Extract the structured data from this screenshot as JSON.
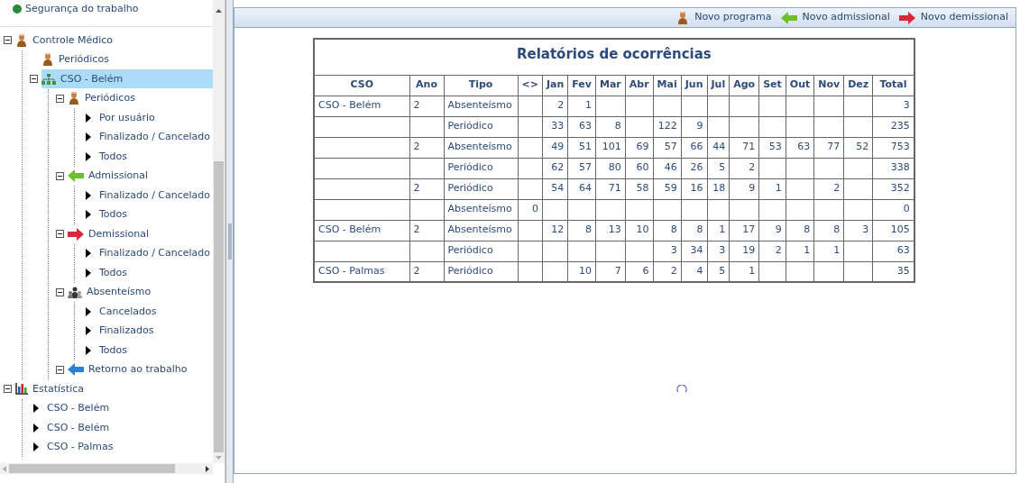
{
  "tree": {
    "top_item": {
      "label": "Segurança do trabalho"
    },
    "nodes": [
      {
        "label": "Controle Médico",
        "kind": "doctor",
        "expanded": true,
        "selected": false,
        "children": [
          {
            "label": "Periódicos",
            "kind": "doctor",
            "selected": false
          },
          {
            "label": "CSO - Belém",
            "kind": "network",
            "expanded": true,
            "selected": true,
            "children": [
              {
                "label": "Periódicos",
                "kind": "doctor",
                "expanded": true,
                "selected": false,
                "children": [
                  {
                    "label": "Por usuário",
                    "kind": "leaf",
                    "selected": false
                  },
                  {
                    "label": "Finalizado / Cancelado",
                    "kind": "leaf",
                    "selected": false
                  },
                  {
                    "label": "Todos",
                    "kind": "leaf",
                    "selected": false
                  }
                ]
              },
              {
                "label": "Admissional",
                "kind": "arrow-green",
                "expanded": true,
                "selected": false,
                "children": [
                  {
                    "label": "Finalizado / Cancelado",
                    "kind": "leaf",
                    "selected": false
                  },
                  {
                    "label": "Todos",
                    "kind": "leaf",
                    "selected": false
                  }
                ]
              },
              {
                "label": "Demissional",
                "kind": "arrow-red",
                "expanded": true,
                "selected": false,
                "children": [
                  {
                    "label": "Finalizado / Cancelado",
                    "kind": "leaf",
                    "selected": false
                  },
                  {
                    "label": "Todos",
                    "kind": "leaf",
                    "selected": false
                  }
                ]
              },
              {
                "label": "Absenteísmo",
                "kind": "people",
                "expanded": true,
                "selected": false,
                "children": [
                  {
                    "label": "Cancelados",
                    "kind": "leaf",
                    "selected": false
                  },
                  {
                    "label": "Finalizados",
                    "kind": "leaf",
                    "selected": false
                  },
                  {
                    "label": "Todos",
                    "kind": "leaf",
                    "selected": false
                  }
                ]
              },
              {
                "label": "Retorno ao trabalho",
                "kind": "arrow-blue",
                "expanded": true,
                "selected": false
              }
            ]
          }
        ]
      },
      {
        "label": "Estatística",
        "kind": "chart",
        "expanded": true,
        "selected": false,
        "children": [
          {
            "label": "CSO - Belém",
            "kind": "leaf",
            "selected": false
          },
          {
            "label": "CSO - Belém",
            "kind": "leaf",
            "selected": false
          },
          {
            "label": "CSO - Palmas",
            "kind": "leaf",
            "selected": false
          }
        ]
      }
    ]
  },
  "toolbar": [
    {
      "label": "Novo programa",
      "kind": "doctor"
    },
    {
      "label": "Novo admissional",
      "kind": "arrow-green"
    },
    {
      "label": "Novo demissional",
      "kind": "arrow-red"
    }
  ],
  "report": {
    "title": "Relatórios de ocorrências",
    "columns": [
      "CSO",
      "Ano",
      "Tipo",
      "<>",
      "Jan",
      "Fev",
      "Mar",
      "Abr",
      "Mai",
      "Jun",
      "Jul",
      "Ago",
      "Set",
      "Out",
      "Nov",
      "Dez",
      "Total"
    ],
    "rows": [
      [
        "CSO - Belém",
        "2",
        "Absenteísmo",
        null,
        "2",
        "1",
        null,
        null,
        null,
        null,
        null,
        null,
        null,
        null,
        null,
        null,
        "3"
      ],
      [
        null,
        null,
        "Periódico",
        null,
        "33",
        "63",
        "8",
        null,
        "122",
        "9",
        null,
        null,
        null,
        null,
        null,
        null,
        "235"
      ],
      [
        null,
        "2",
        "Absenteísmo",
        null,
        "49",
        "51",
        "101",
        "69",
        "57",
        "66",
        "44",
        "71",
        "53",
        "63",
        "77",
        "52",
        "753"
      ],
      [
        null,
        null,
        "Periódico",
        null,
        "62",
        "57",
        "80",
        "60",
        "46",
        "26",
        "5",
        "2",
        null,
        null,
        null,
        null,
        "338"
      ],
      [
        null,
        "2",
        "Periódico",
        null,
        "54",
        "64",
        "71",
        "58",
        "59",
        "16",
        "18",
        "9",
        "1",
        null,
        "2",
        null,
        "352"
      ],
      [
        null,
        null,
        "Absenteísmo",
        "0",
        null,
        null,
        null,
        null,
        null,
        null,
        null,
        null,
        null,
        null,
        null,
        null,
        "0"
      ],
      [
        "CSO - Belém",
        "2",
        "Absenteísmo",
        null,
        "12",
        "8",
        "13",
        "10",
        "8",
        "8",
        "1",
        "17",
        "9",
        "8",
        "8",
        "3",
        "105"
      ],
      [
        null,
        null,
        "Periódico",
        null,
        null,
        null,
        null,
        null,
        "3",
        "34",
        "3",
        "19",
        "2",
        "1",
        "1",
        null,
        "63"
      ],
      [
        "CSO - Palmas",
        "2",
        "Periódico",
        null,
        null,
        "10",
        "7",
        "6",
        "2",
        "4",
        "5",
        "1",
        null,
        null,
        null,
        null,
        "35"
      ]
    ]
  }
}
